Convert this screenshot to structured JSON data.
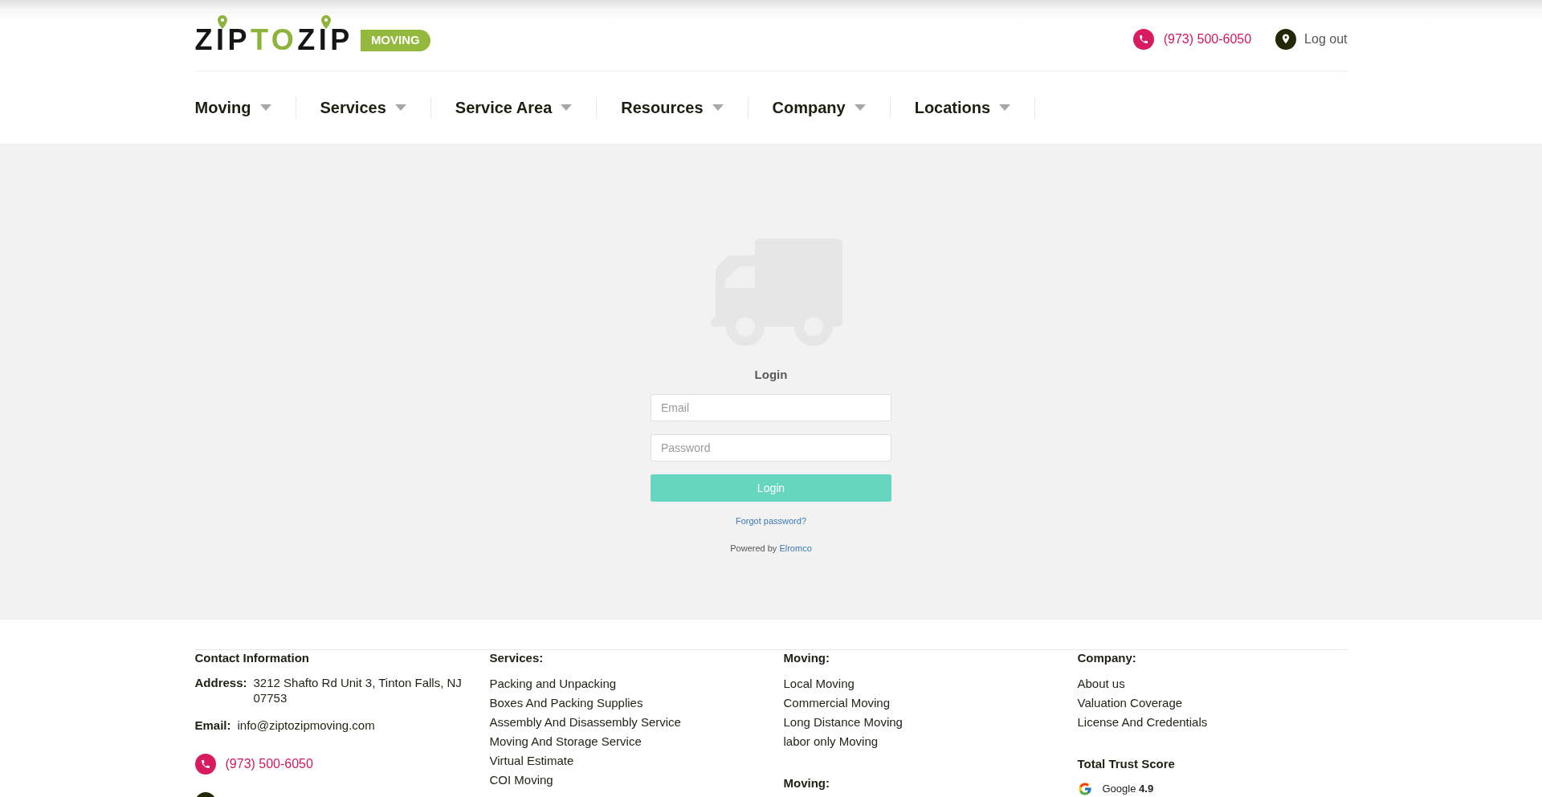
{
  "header": {
    "logo": {
      "parts": [
        {
          "text": "ZIP",
          "kind": "dark"
        },
        {
          "text": "TO",
          "kind": "accent"
        },
        {
          "text": "ZIP",
          "kind": "dark"
        }
      ],
      "badge": "MOVING"
    },
    "phone": "(973) 500-6050",
    "account_link": "Log out"
  },
  "nav": {
    "items": [
      {
        "label": "Moving"
      },
      {
        "label": "Services"
      },
      {
        "label": "Service Area"
      },
      {
        "label": "Resources"
      },
      {
        "label": "Company"
      },
      {
        "label": "Locations"
      }
    ]
  },
  "login": {
    "title": "Login",
    "fields": [
      {
        "placeholder": "Email"
      },
      {
        "placeholder": "Password"
      }
    ],
    "submit": "Login",
    "forgot_link": "Forgot password?",
    "powered_by": {
      "text": "Powered by",
      "link": "Elromco"
    }
  },
  "footer": {
    "columns": [
      {
        "blocks": [
          {
            "kind": "contact",
            "heading": "Contact Information",
            "rows": [
              {
                "label": "Address:",
                "value": "3212 Shafto Rd Unit 3, Tinton Falls, NJ 07753"
              },
              {
                "label": "Email:",
                "value": "info@ziptozipmoving.com"
              }
            ]
          },
          {
            "kind": "phone",
            "number": "(973) 500-6050"
          },
          {
            "kind": "location"
          }
        ]
      },
      {
        "blocks": [
          {
            "kind": "links",
            "heading": "Services:",
            "links": [
              "Packing and Unpacking",
              "Boxes And Packing Supplies",
              "Assembly And Disassembly Service",
              "Moving And Storage Service",
              "Virtual Estimate",
              "COI Moving"
            ]
          }
        ]
      },
      {
        "blocks": [
          {
            "kind": "links",
            "heading": "Moving:",
            "links": [
              "Local Moving",
              "Commercial Moving",
              "Long Distance Moving",
              "labor only Moving"
            ]
          },
          {
            "kind": "links",
            "heading": "Moving:"
          }
        ]
      },
      {
        "blocks": [
          {
            "kind": "links",
            "heading": "Company:",
            "links": [
              "About us",
              "Valuation Coverage",
              "License And Credentials"
            ]
          },
          {
            "kind": "trust",
            "heading": "Total Trust Score",
            "sources": [
              "Google **4.9**"
            ]
          }
        ]
      }
    ]
  }
}
